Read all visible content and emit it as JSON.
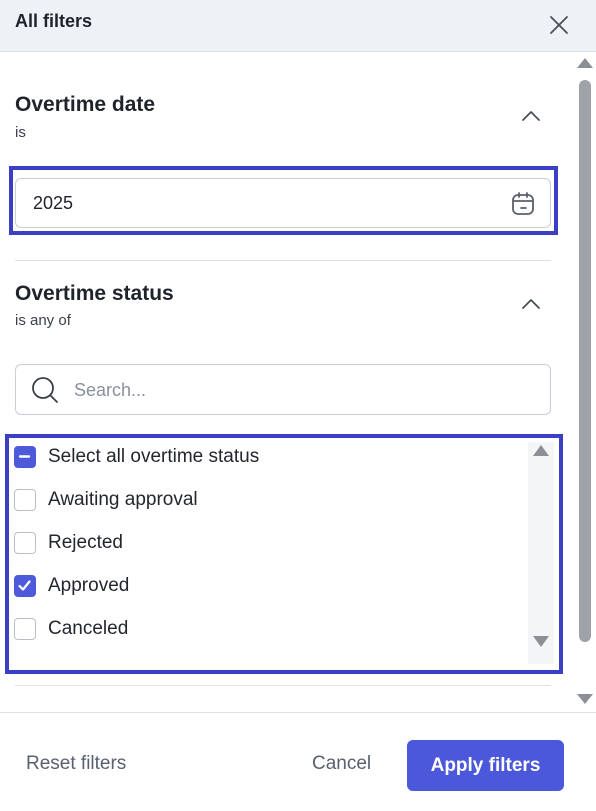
{
  "header": {
    "title": "All filters",
    "close_icon": "close-icon"
  },
  "sections": {
    "date": {
      "title": "Overtime date",
      "operator": "is",
      "value": "2025",
      "chevron_icon": "chevron-up-icon",
      "calendar_icon": "calendar-icon"
    },
    "status": {
      "title": "Overtime status",
      "operator": "is any of",
      "chevron_icon": "chevron-up-icon",
      "search": {
        "placeholder": "Search...",
        "value": "",
        "icon": "search-icon"
      },
      "select_all": {
        "label": "Select all overtime status",
        "state": "indeterminate"
      },
      "options": [
        {
          "label": "Awaiting approval",
          "checked": false
        },
        {
          "label": "Rejected",
          "checked": false
        },
        {
          "label": "Approved",
          "checked": true
        },
        {
          "label": "Canceled",
          "checked": false
        }
      ]
    }
  },
  "footer": {
    "reset_label": "Reset filters",
    "cancel_label": "Cancel",
    "apply_label": "Apply filters"
  },
  "colors": {
    "accent": "#4a58d9",
    "highlight_border": "#3b3fc4",
    "header_bg": "#eef2f7"
  }
}
